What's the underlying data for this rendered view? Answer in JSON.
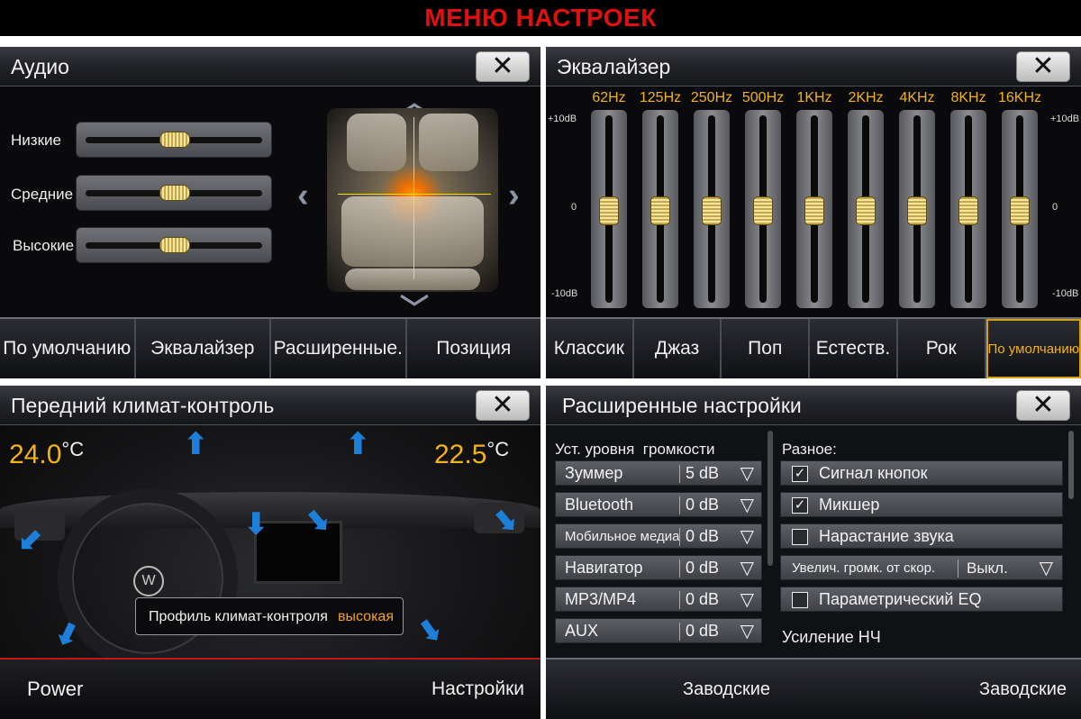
{
  "banner": {
    "title": "МЕНЮ НАСТРОЕК"
  },
  "audio": {
    "title": "Аудио",
    "sliders": [
      {
        "label": "Низкие",
        "level": 0.5
      },
      {
        "label": "Средние",
        "level": 0.5
      },
      {
        "label": "Высокие",
        "level": 0.5
      }
    ],
    "tabs": [
      "По умолчанию",
      "Эквалайзер",
      "Расширенные.",
      "Позиция"
    ]
  },
  "eq": {
    "title": "Эквалайзер",
    "bands": [
      {
        "freq": "62Hz",
        "db": 0
      },
      {
        "freq": "125Hz",
        "db": 0
      },
      {
        "freq": "250Hz",
        "db": 0
      },
      {
        "freq": "500Hz",
        "db": 0
      },
      {
        "freq": "1KHz",
        "db": 0
      },
      {
        "freq": "2KHz",
        "db": 0
      },
      {
        "freq": "4KHz",
        "db": 0
      },
      {
        "freq": "8KHz",
        "db": 0
      },
      {
        "freq": "16KHz",
        "db": 0
      }
    ],
    "scale": {
      "top": "+10dB",
      "mid": "0",
      "bottom": "-10dB"
    },
    "presets": [
      "Классик",
      "Джаз",
      "Поп",
      "Естеств.",
      "Рок",
      "По умолчанию"
    ],
    "active_preset": "По умолчанию"
  },
  "climate": {
    "title": "Передний климат-контроль",
    "temp_left": "24.0",
    "temp_right": "22.5",
    "unit": "°C",
    "profile_label": "Профиль климат-контроля",
    "profile_value": "высокая",
    "power_label": "Power",
    "settings_label": "Настройки"
  },
  "advanced": {
    "title": "Расширенные настройки",
    "volume_header": "Уст. уровня  громкости",
    "volumes": [
      {
        "name": "Зуммер",
        "value": "5 dB"
      },
      {
        "name": "Bluetooth",
        "value": "0 dB"
      },
      {
        "name": "Мобильное медиа",
        "value": "0 dB"
      },
      {
        "name": "Навигатор",
        "value": "0 dB"
      },
      {
        "name": "MP3/MP4",
        "value": "0 dB"
      },
      {
        "name": "AUX",
        "value": "0 dB"
      }
    ],
    "misc_header": "Разное:",
    "options": [
      {
        "name": "Сигнал кнопок",
        "checked": true
      },
      {
        "name": "Микшер",
        "checked": true
      },
      {
        "name": "Нарастание звука",
        "checked": false
      }
    ],
    "speed_label": "Увелич. громк. от скор.",
    "speed_value": "Выкл.",
    "peq_label": "Параметрический EQ",
    "bass_label": "Усиление НЧ",
    "factory_left": "Заводские",
    "factory_right": "Заводские"
  },
  "colors": {
    "accent_orange": "#f2b318",
    "banner_red": "#e01010",
    "air_blue": "#1e7fd8"
  }
}
